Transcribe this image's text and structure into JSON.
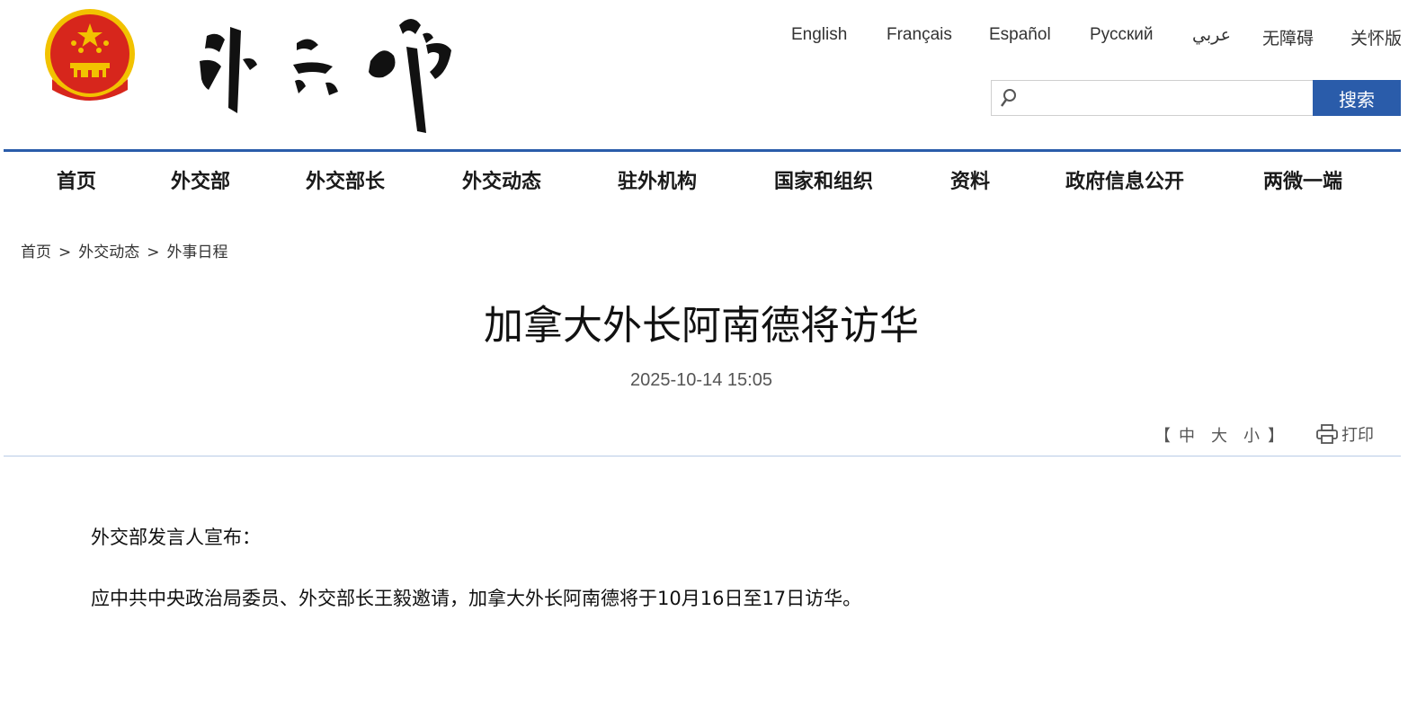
{
  "header": {
    "languages": [
      "English",
      "Français",
      "Español",
      "Русский",
      "عربي",
      "无障碍",
      "关怀版"
    ],
    "search": {
      "placeholder": "",
      "button_label": "搜索"
    }
  },
  "nav": {
    "items": [
      "首页",
      "外交部",
      "外交部长",
      "外交动态",
      "驻外机构",
      "国家和组织",
      "资料",
      "政府信息公开",
      "两微一端"
    ]
  },
  "breadcrumb": {
    "items": [
      "首页",
      "外交动态",
      "外事日程"
    ],
    "separator": ">"
  },
  "article": {
    "title": "加拿大外长阿南德将访华",
    "date": "2025-10-14 15:05",
    "font_size": {
      "open": "【",
      "options": [
        "中",
        "大",
        "小"
      ],
      "close": "】"
    },
    "print_label": "打印",
    "paragraphs": [
      "外交部发言人宣布：",
      "应中共中央政治局委员、外交部长王毅邀请，加拿大外长阿南德将于10月16日至17日访华。"
    ]
  },
  "colors": {
    "accent": "#2a5caa",
    "emblem_red": "#d7261c",
    "emblem_gold": "#f2c200"
  },
  "icons": {
    "logo": "national-emblem-icon",
    "wordmark": "ministry-calligraphy-logo",
    "search": "search-icon",
    "print": "printer-icon"
  }
}
